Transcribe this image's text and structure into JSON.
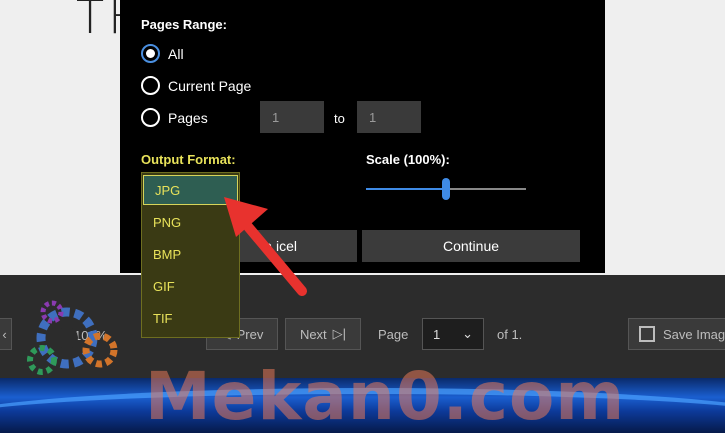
{
  "document": {
    "title_fragment": "TH"
  },
  "dialog": {
    "pages_range_label": "Pages Range:",
    "radios": [
      {
        "label": "All",
        "checked": true
      },
      {
        "label": "Current Page",
        "checked": false
      },
      {
        "label": "Pages",
        "checked": false
      }
    ],
    "pages_from": "1",
    "to_label": "to",
    "pages_to": "1",
    "output_format_label": "Output Format:",
    "scale_label": "Scale (100%):",
    "scale_fraction": 0.5,
    "cancel_label_fragment": "a icel",
    "continue_label": "Continue",
    "format_options": [
      "JPG",
      "PNG",
      "BMP",
      "GIF",
      "TIF"
    ],
    "selected_format": "JPG"
  },
  "viewer_toolbar": {
    "zoom": "100%",
    "prev_label": "Prev",
    "next_label": "Next",
    "page_label": "Page",
    "page_value": "1",
    "of_label": "of 1.",
    "save_label": "Save Imag"
  },
  "watermark": {
    "text": "Mekan0.com"
  },
  "colors": {
    "accent": "#3f8be6",
    "highlight_text": "#e8e25a",
    "arrow": "#e8322e"
  }
}
